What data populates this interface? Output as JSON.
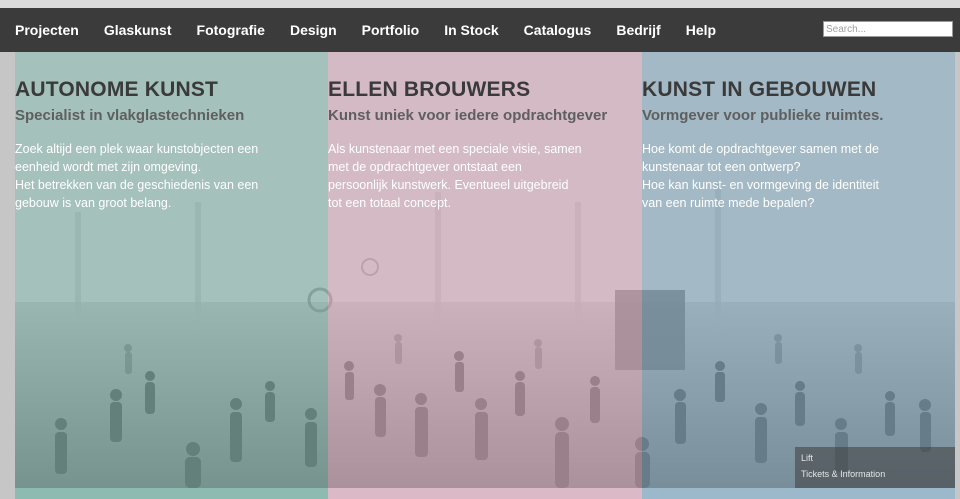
{
  "nav": {
    "items": [
      "Projecten",
      "Glaskunst",
      "Fotografie",
      "Design",
      "Portfolio",
      "In Stock",
      "Catalogus",
      "Bedrijf",
      "Help"
    ],
    "search_placeholder": "Search..."
  },
  "columns": [
    {
      "title": "AUTONOME KUNST",
      "subtitle": "Specialist in vlakglastechnieken",
      "lines": [
        "Zoek altijd een plek waar kunstobjecten een",
        "eenheid wordt met zijn omgeving.",
        "Het betrekken van de geschiedenis van een",
        "gebouw is van groot belang."
      ],
      "color": "#6eafa5"
    },
    {
      "title": "ELLEN BROUWERS",
      "subtitle": "Kunst uniek voor iedere opdrachtgever",
      "lines": [
        "Als kunstenaar met een speciale visie, samen",
        "met de opdrachtgever ontstaat een",
        "persoonlijk kunstwerk. Eventueel uitgebreid",
        "tot een totaal concept."
      ],
      "color": "#d7a5b9"
    },
    {
      "title": "KUNST IN GEBOUWEN",
      "subtitle": "Vormgever voor publieke ruimtes.",
      "lines": [
        "Hoe komt de opdrachtgever samen met de",
        "kunstenaar tot een ontwerp?",
        "Hoe kan kunst- en vormgeving  de identiteit",
        "van een ruimte mede bepalen?"
      ],
      "color": "#73a0b9"
    }
  ],
  "signage": {
    "line1": "Lift",
    "line2": "Tickets & Information"
  },
  "colors": {
    "nav_background": "#3b3b3b",
    "nav_text": "#ffffff",
    "heading_text": "#3a3a3a",
    "subheading_text": "#5f5f5f"
  }
}
